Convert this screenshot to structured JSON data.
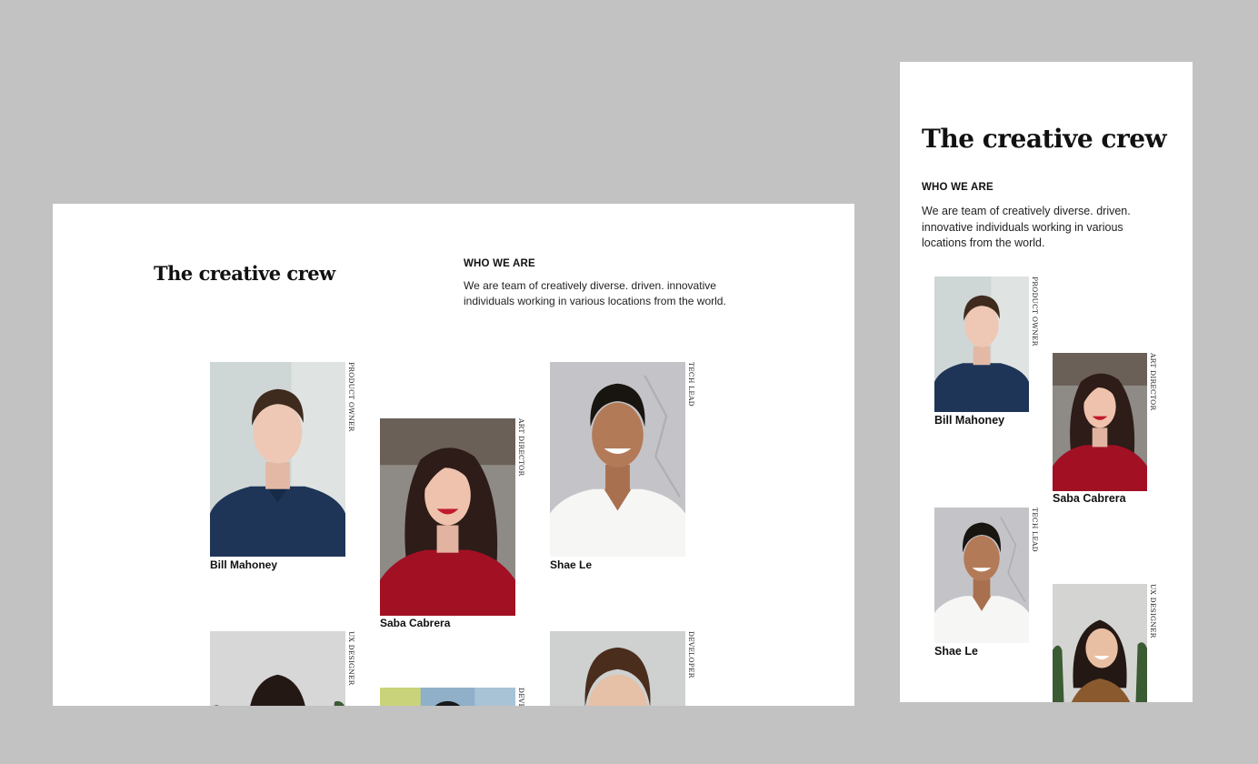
{
  "heading": "The creative crew",
  "about": {
    "label": "WHO WE ARE",
    "text": "We are team of creatively diverse. driven. innovative individuals working in various locations from the world."
  },
  "members": [
    {
      "name": "Bill Mahoney",
      "role": "PRODUCT OWNER"
    },
    {
      "name": "Saba Cabrera",
      "role": "ART DIRECTOR"
    },
    {
      "name": "Shae Le",
      "role": "TECH LEAD"
    },
    {
      "name": "",
      "role": "UX DESIGNER"
    },
    {
      "name": "",
      "role": "DEVELOPER"
    },
    {
      "name": "",
      "role": "DEVELOPER"
    }
  ]
}
